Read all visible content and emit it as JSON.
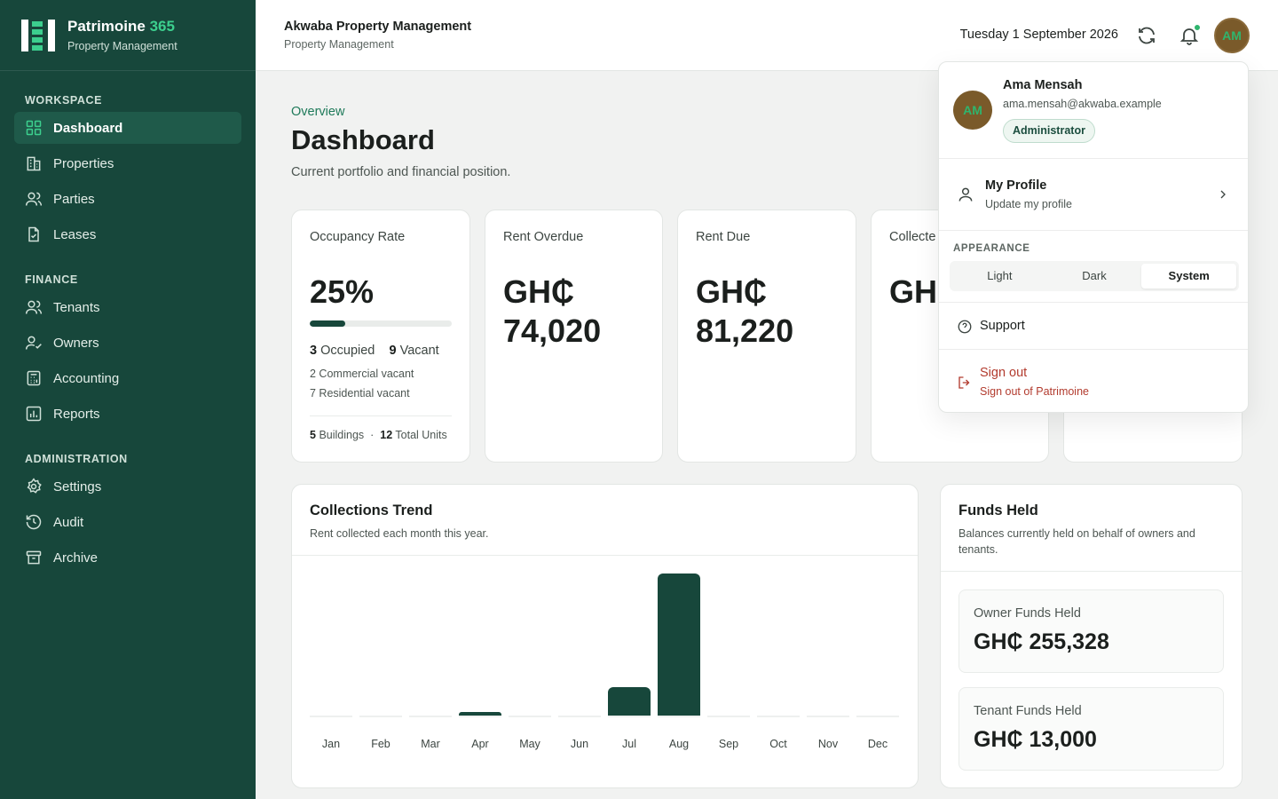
{
  "brand": {
    "name": "Patrimoine",
    "version": "365",
    "subtitle": "Property Management"
  },
  "sidebar": {
    "sections": [
      {
        "title": "WORKSPACE",
        "items": [
          {
            "label": "Dashboard",
            "icon": "grid-icon",
            "active": true
          },
          {
            "label": "Properties",
            "icon": "building-icon"
          },
          {
            "label": "Parties",
            "icon": "users-icon"
          },
          {
            "label": "Leases",
            "icon": "document-icon"
          }
        ]
      },
      {
        "title": "FINANCE",
        "items": [
          {
            "label": "Tenants",
            "icon": "users-icon"
          },
          {
            "label": "Owners",
            "icon": "user-check-icon"
          },
          {
            "label": "Accounting",
            "icon": "calculator-icon"
          },
          {
            "label": "Reports",
            "icon": "bar-chart-icon"
          }
        ]
      },
      {
        "title": "ADMINISTRATION",
        "items": [
          {
            "label": "Settings",
            "icon": "gear-icon"
          },
          {
            "label": "Audit",
            "icon": "history-icon"
          },
          {
            "label": "Archive",
            "icon": "archive-icon"
          }
        ]
      }
    ]
  },
  "header": {
    "org_name": "Akwaba Property Management",
    "org_subtitle": "Property Management",
    "date": "Tuesday 1 September 2026",
    "avatar_initials": "AM"
  },
  "page": {
    "eyebrow": "Overview",
    "title": "Dashboard",
    "description": "Current portfolio and financial position."
  },
  "kpis": {
    "occupancy": {
      "label": "Occupancy Rate",
      "value": "25%",
      "progress": 0.25,
      "occupied_count": "3",
      "occupied_label": "Occupied",
      "vacant_count": "9",
      "vacant_label": "Vacant",
      "commercial_vacant": "2 Commercial vacant",
      "residential_vacant": "7 Residential vacant",
      "buildings_count": "5",
      "buildings_label": "Buildings",
      "separator": "·",
      "units_count": "12",
      "units_label": "Total Units"
    },
    "rent_overdue": {
      "label": "Rent Overdue",
      "currency": "GH₵",
      "amount": "74,020"
    },
    "rent_due": {
      "label": "Rent Due",
      "currency": "GH₵",
      "amount": "81,220"
    },
    "collected": {
      "label": "Collecte",
      "value": "GH"
    }
  },
  "collections": {
    "title": "Collections Trend",
    "subtitle": "Rent collected each month this year."
  },
  "chart_data": {
    "type": "bar",
    "categories": [
      "Jan",
      "Feb",
      "Mar",
      "Apr",
      "May",
      "Jun",
      "Jul",
      "Aug",
      "Sep",
      "Oct",
      "Nov",
      "Dec"
    ],
    "values": [
      0,
      0,
      0,
      2.5,
      0,
      0,
      20,
      100,
      0,
      0,
      0,
      0
    ],
    "title": "Collections Trend",
    "xlabel": "",
    "ylabel": "",
    "ylim": [
      0,
      100
    ],
    "grid": false,
    "color": "#17473b"
  },
  "funds": {
    "title": "Funds Held",
    "subtitle": "Balances currently held on behalf of owners and tenants.",
    "owner": {
      "label": "Owner Funds Held",
      "value": "GH₵ 255,328"
    },
    "tenant": {
      "label": "Tenant Funds Held",
      "value": "GH₵ 13,000"
    }
  },
  "menu": {
    "user_name": "Ama Mensah",
    "user_email": "ama.mensah@akwaba.example",
    "role": "Administrator",
    "initials": "AM",
    "profile_title": "My Profile",
    "profile_sub": "Update my profile",
    "appearance_label": "APPEARANCE",
    "appearance_options": [
      "Light",
      "Dark",
      "System"
    ],
    "appearance_selected": "System",
    "support": "Support",
    "signout_title": "Sign out",
    "signout_sub": "Sign out of Patrimoine"
  },
  "colors": {
    "sidebar": "#17473b",
    "accent": "#3ccf8e",
    "danger": "#b23b2e",
    "avatar": "#7a5a2a"
  }
}
